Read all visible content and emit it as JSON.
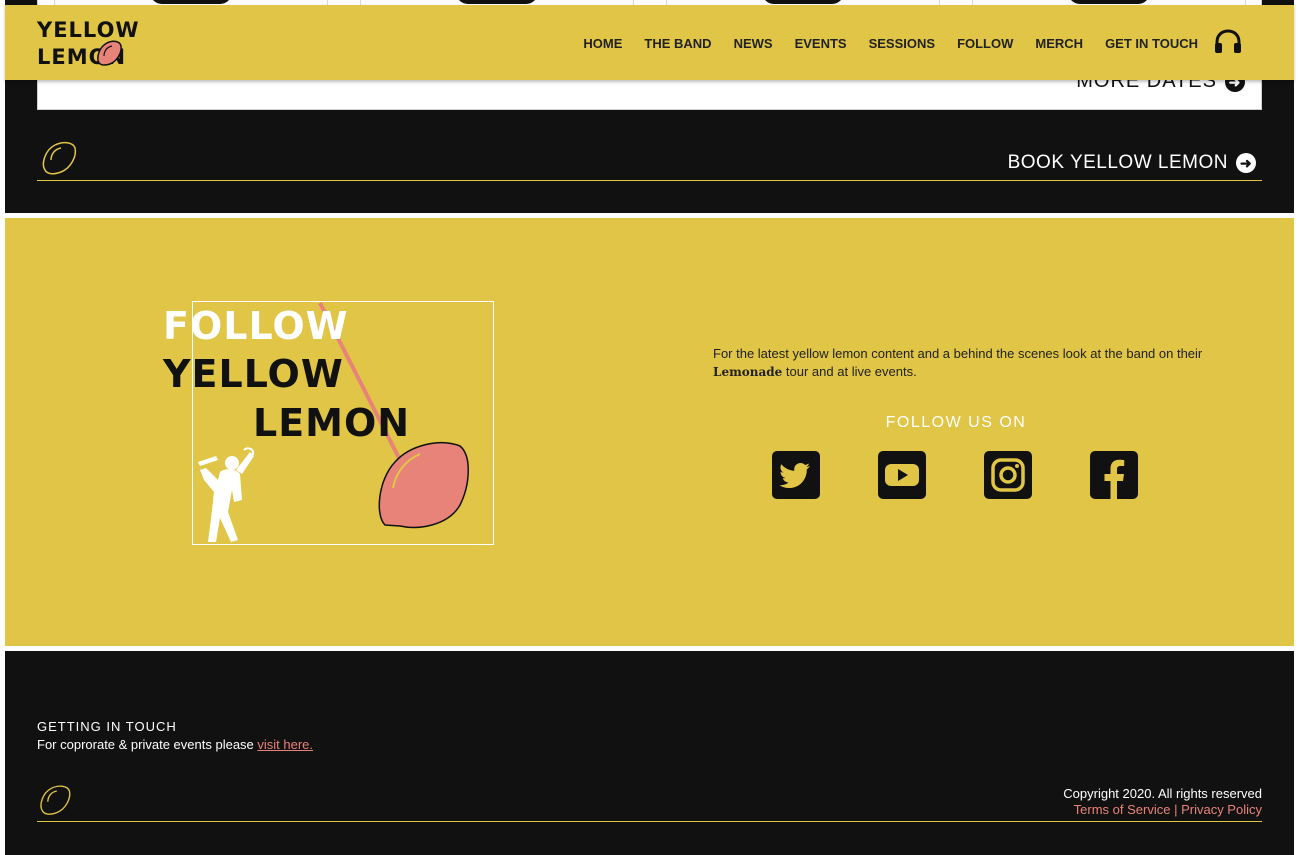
{
  "nav": {
    "logo_line1": "YELLOW",
    "logo_line2": "LEMON",
    "links": [
      "HOME",
      "THE BAND",
      "NEWS",
      "EVENTS",
      "SESSIONS",
      "FOLLOW",
      "MERCH",
      "GET IN TOUCH"
    ],
    "listen_icon": "headphones-icon"
  },
  "events": {
    "more_dates": "MORE DATES",
    "book_label": "BOOK YELLOW LEMON"
  },
  "follow": {
    "title_line1": "FOLLOW",
    "title_line2": "YELLOW",
    "title_line3": "LEMON",
    "description_before": "For the latest yellow lemon content and a behind the scenes look at the band on their ",
    "description_em": "Lemonade",
    "description_after": " tour and at live events.",
    "follow_us_on": "FOLLOW US ON",
    "socials": [
      "twitter-icon",
      "youtube-icon",
      "instagram-icon",
      "facebook-icon"
    ]
  },
  "footer": {
    "getting_in_touch": "GETTING IN TOUCH",
    "events_text": "For coprorate & private events please ",
    "visit_link": "visit here.",
    "copyright": "Copyright 2020. All rights reserved",
    "terms": "Terms of Service",
    "separator": " | ",
    "privacy": "Privacy Policy"
  },
  "colors": {
    "brand_yellow": "#e0c546",
    "lemon_pink": "#e8837a",
    "dark": "#111111",
    "white": "#ffffff"
  }
}
